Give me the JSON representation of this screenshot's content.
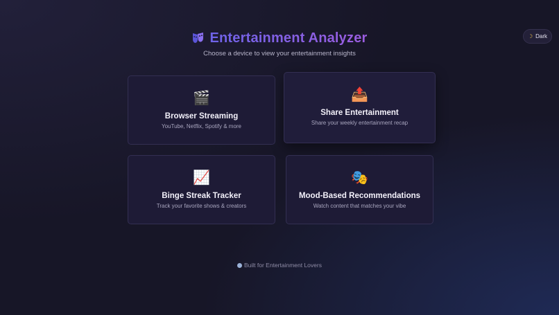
{
  "theme_toggle": {
    "label": "Dark",
    "icon": "moon-icon"
  },
  "header": {
    "title": "Entertainment Analyzer",
    "subtitle": "Choose a device to view your entertainment insights",
    "title_icon": "masks-icon"
  },
  "cards": [
    {
      "icon": "clapper-board-icon",
      "title": "Browser Streaming",
      "description": "YouTube, Netflix, Spotify & more"
    },
    {
      "icon": "outbox-tray-icon",
      "title": "Share Entertainment",
      "description": "Share your weekly entertainment recap"
    },
    {
      "icon": "chart-increasing-icon",
      "title": "Binge Streak Tracker",
      "description": "Track your favorite shows & creators"
    },
    {
      "icon": "performing-arts-icon",
      "title": "Mood-Based Recommendations",
      "description": "Watch content that matches your vibe"
    }
  ],
  "footer": {
    "text": "Built for Entertainment Lovers"
  },
  "colors": {
    "background": "#171627",
    "card": "#1e1b36",
    "card_border": "#332f52",
    "title_gradient_start": "#6e63e8",
    "title_gradient_end": "#9c5de0",
    "footer_dot": "#9bb2d8"
  }
}
